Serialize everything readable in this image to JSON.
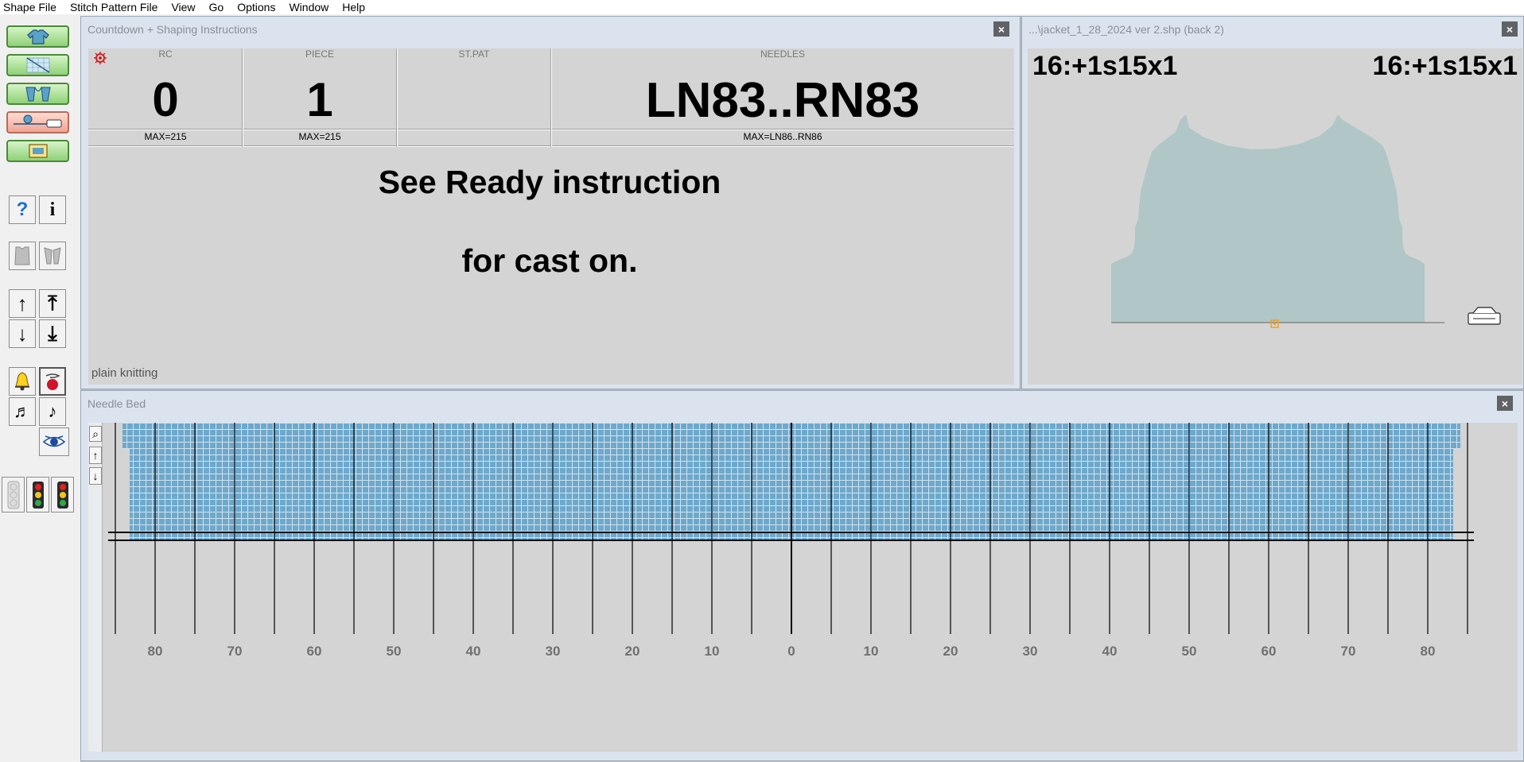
{
  "menu": [
    "Shape File",
    "Stitch Pattern File",
    "View",
    "Go",
    "Options",
    "Window",
    "Help"
  ],
  "icons": {
    "toolbar_green": [
      "sweater-icon",
      "shape-grid-icon",
      "sleeves-icon",
      "carriage-yarn-icon",
      "picture-icon"
    ],
    "help": "help-icon",
    "info": "info-icon",
    "bell": "bell-icon",
    "yarn": "yarn-icon"
  },
  "glyphs": {
    "help": "?",
    "info": "i",
    "arrow_up": "↑",
    "arrow_top": "⤒",
    "arrow_down": "↓",
    "arrow_bottom": "⤓",
    "music_double": "♬",
    "music_single": "♪",
    "close": "×",
    "zoom": "⌕",
    "up": "↑",
    "down": "↓"
  },
  "countdown": {
    "title": "Countdown + Shaping Instructions",
    "columns": [
      {
        "header": "RC",
        "value": "0",
        "max": "MAX=215"
      },
      {
        "header": "PIECE",
        "value": "1",
        "max": "MAX=215"
      },
      {
        "header": "ST.PAT",
        "value": "",
        "max": ""
      },
      {
        "header": "NEEDLES",
        "value": "LN83..RN83",
        "max": "MAX=LN86..RN86"
      }
    ],
    "instruction_line1": "See Ready instruction",
    "instruction_line2": "for cast on.",
    "footer": "plain knitting"
  },
  "shape": {
    "title": "...\\jacket_1_28_2024 ver 2.shp (back 2)",
    "left_label": "16:+1s15x1",
    "right_label": "16:+1s15x1"
  },
  "needlebed": {
    "title": "Needle Bed",
    "tick_labels": [
      "80",
      "70",
      "60",
      "50",
      "40",
      "30",
      "20",
      "10",
      "0",
      "10",
      "20",
      "30",
      "40",
      "50",
      "60",
      "70",
      "80"
    ]
  },
  "colors": {
    "shape_fill": "#b0c6c7",
    "knit_fill": "#6ea8cb",
    "button_green": "#8fd177",
    "close_button": "#5f6366"
  }
}
